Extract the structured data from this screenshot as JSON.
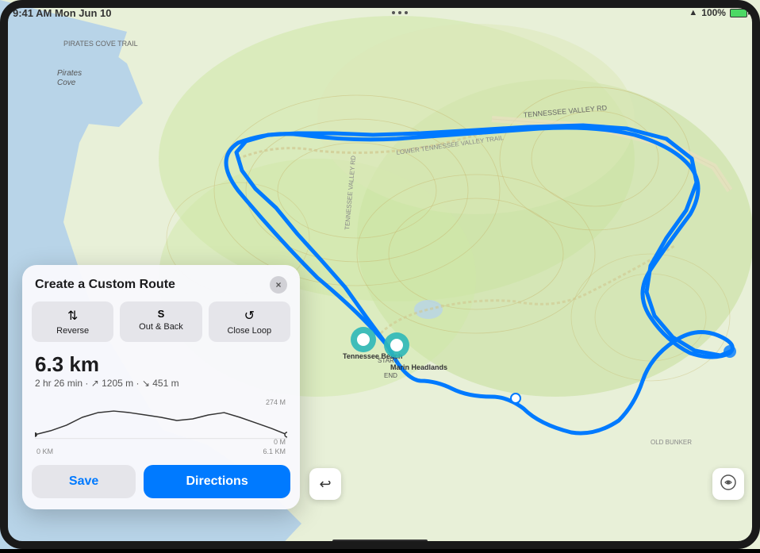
{
  "status_bar": {
    "time": "9:41 AM Mon Jun 10",
    "wifi": "WiFi",
    "battery_pct": "100%"
  },
  "map": {
    "pirate_cove_label": "Pirates Cove",
    "pirate_cove_trail_label": "PIRATES COVE TRAIL",
    "tennessee_valley_label": "TENNESSEE VALLEY RD",
    "tennessee_trail_label": "LOWER TENNESSEE VALLEY TRAIL",
    "tennessee_valley_rd_label": "TENNESSEE VALLEY RD",
    "old_bunker_label": "OLD BUNKER",
    "beach_label": "Tennessee Beach",
    "marin_label": "Marin Headlands",
    "start_label": "START",
    "end_label": "END"
  },
  "panel": {
    "title": "Create a Custom Route",
    "close_label": "×",
    "buttons": [
      {
        "id": "reverse",
        "icon": "⇅",
        "label": "Reverse"
      },
      {
        "id": "out-back",
        "icon": "S",
        "label": "Out & Back"
      },
      {
        "id": "close-loop",
        "icon": "↺",
        "label": "Close Loop"
      }
    ],
    "distance": "6.3 km",
    "duration": "2 hr 26 min",
    "elevation_up": "↗ 1205 m",
    "elevation_down": "↘ 451 m",
    "elevation_max_label": "274 M",
    "elevation_min_label": "0 M",
    "x_start_label": "0 KM",
    "x_end_label": "6.1 KM",
    "save_label": "Save",
    "directions_label": "Directions"
  },
  "map_controls": {
    "undo_icon": "↩",
    "layers_icon": "⊞"
  }
}
